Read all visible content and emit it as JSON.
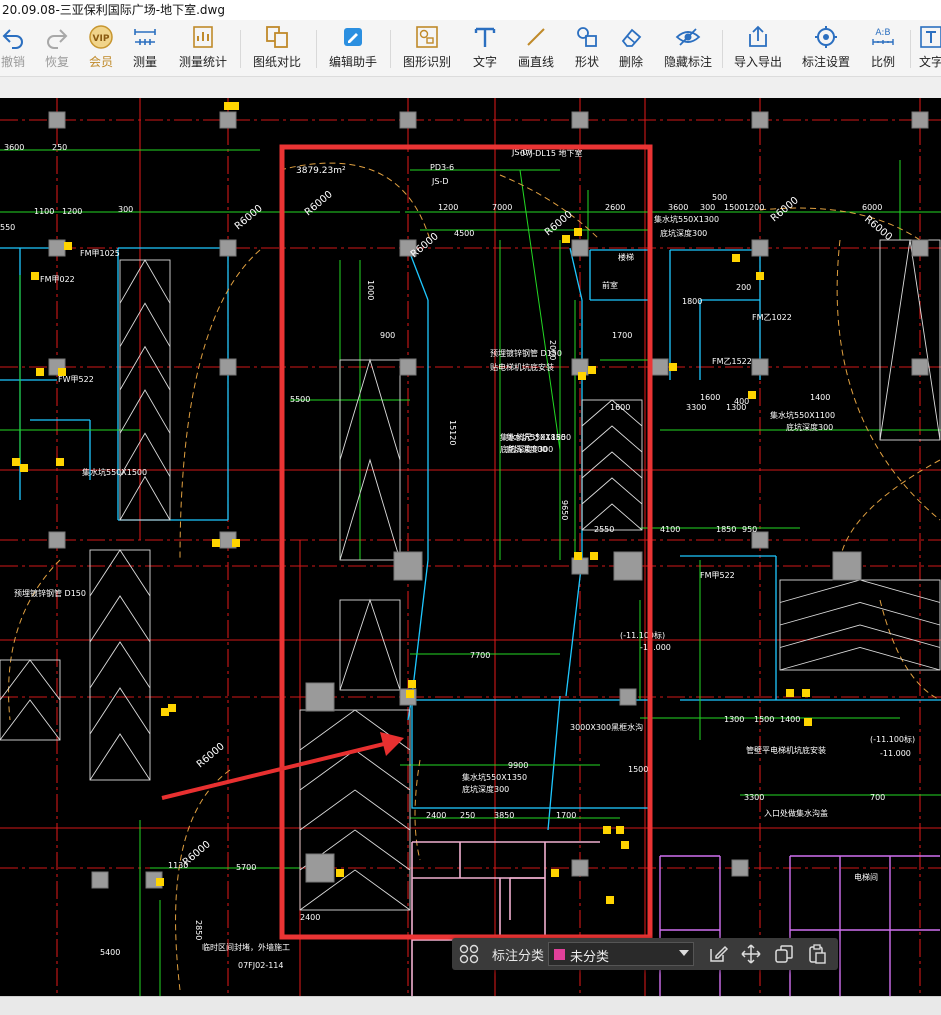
{
  "window": {
    "title": "20.09.08-三亚保利国际广场-地下室.dwg"
  },
  "toolbar": {
    "items": [
      {
        "label": "撤销",
        "icon": "undo-icon"
      },
      {
        "label": "恢复",
        "icon": "redo-icon"
      },
      {
        "label": "会员",
        "icon": "vip-icon"
      },
      {
        "label": "测量",
        "icon": "measure-icon"
      },
      {
        "label": "测量统计",
        "icon": "measure-stats-icon"
      },
      {
        "label": "图纸对比",
        "icon": "compare-icon"
      },
      {
        "label": "编辑助手",
        "icon": "edit-assistant-icon"
      },
      {
        "label": "图形识别",
        "icon": "shape-recognition-icon"
      },
      {
        "label": "文字",
        "icon": "text-icon"
      },
      {
        "label": "画直线",
        "icon": "line-icon"
      },
      {
        "label": "形状",
        "icon": "shape-icon"
      },
      {
        "label": "删除",
        "icon": "eraser-icon"
      },
      {
        "label": "隐藏标注",
        "icon": "eye-hide-icon"
      },
      {
        "label": "导入导出",
        "icon": "import-export-icon"
      },
      {
        "label": "标注设置",
        "icon": "annotation-settings-icon"
      },
      {
        "label": "比例",
        "icon": "scale-icon"
      },
      {
        "label": "文字",
        "icon": "text-icon"
      }
    ]
  },
  "annotation_bar": {
    "category_label": "标注分类",
    "category_value": "未分类",
    "category_color": "#e0409a"
  },
  "drawing": {
    "area_text": "3879.23m²",
    "dims": [
      "3600",
      "250",
      "1100",
      "1200",
      "300",
      "550",
      "1200",
      "7000",
      "2600",
      "3600",
      "300",
      "1500",
      "1200",
      "6000",
      "4500",
      "5500",
      "15120",
      "9650",
      "2550",
      "4100",
      "1850",
      "950",
      "7700",
      "9900",
      "2400",
      "250",
      "3850",
      "1700",
      "5700",
      "1130",
      "2850",
      "5400",
      "2400",
      "1300",
      "1500",
      "1400",
      "700",
      "3300",
      "1800",
      "1600",
      "400",
      "1000",
      "2000",
      "3300",
      "1300",
      "900",
      "500",
      "200",
      "1700",
      "1600",
      "1400",
      "1500"
    ],
    "radii": [
      "R6000",
      "R6000",
      "R6000",
      "R6000",
      "R6000",
      "R6000",
      "R6000",
      "R6000"
    ],
    "notes": [
      "预埋镀锌钢管 D150",
      "贴电梯机坑底安装",
      "集水坑尺寸X1850",
      "底坑深度800",
      "集水坑550X1850",
      "底坑深度300",
      "集水坑550X1500",
      "集水坑550X1300",
      "底坑深度300",
      "集水坑550X1350",
      "底坑深度300",
      "临时区间封堵，外墙施工",
      "07FJ02-114",
      "集水坑550X1100",
      "底坑深度300",
      "预埋镀锌钢管 D150",
      "管壁平电梯机坑底安装",
      "(-11.100标)",
      "-11.000",
      "(-11.100标)",
      "-11.000",
      "入口处做集水沟盖",
      "3000X300黑框水沟",
      "PD3-6",
      "JS-D",
      "JS-07",
      "FM甲022",
      "FM甲1025",
      "FM甲522",
      "FW甲522",
      "FM乙1522",
      "FM乙1022",
      "07J-DL15 地下室",
      "楼梯",
      "前室",
      "电梯间"
    ]
  }
}
